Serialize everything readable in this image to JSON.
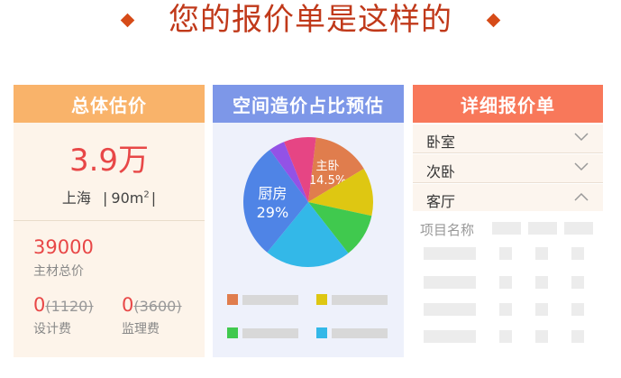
{
  "header": {
    "title": "您的报价单是这样的"
  },
  "estimate": {
    "title": "总体估价",
    "total": "3.9万",
    "city": "上海",
    "area": "90m",
    "area_unit_sup": "2",
    "main_material_total": "39000",
    "main_material_label": "主材总价",
    "design_fee": {
      "value": "0",
      "original": "(1120)",
      "label": "设计费"
    },
    "supervision_fee": {
      "value": "0",
      "original": "(3600)",
      "label": "监理费"
    }
  },
  "cost_share": {
    "title": "空间造价占比预估"
  },
  "chart_data": {
    "type": "pie",
    "title": "空间造价占比预估",
    "slices": [
      {
        "name": "主卧",
        "value": 14.5,
        "label": "14.5%",
        "color": "#e07d4d"
      },
      {
        "name": "",
        "value": 12,
        "color": "#dec712"
      },
      {
        "name": "",
        "value": 11,
        "color": "#40c94e"
      },
      {
        "name": "",
        "value": 21.5,
        "color": "#33b8e8"
      },
      {
        "name": "厨房",
        "value": 29,
        "label": "29%",
        "color": "#4f84e6"
      },
      {
        "name": "",
        "value": 4,
        "color": "#9352e6"
      },
      {
        "name": "",
        "value": 8,
        "color": "#e64584"
      }
    ],
    "legend_colors": [
      "#e07d4d",
      "#dec712",
      "#40c94e",
      "#33b8e8"
    ]
  },
  "quote": {
    "title": "详细报价单",
    "rooms": [
      {
        "label": "卧室",
        "state": "collapsed"
      },
      {
        "label": "次卧",
        "state": "collapsed"
      },
      {
        "label": "客厅",
        "state": "expanded"
      }
    ],
    "table_header": "项目名称"
  }
}
